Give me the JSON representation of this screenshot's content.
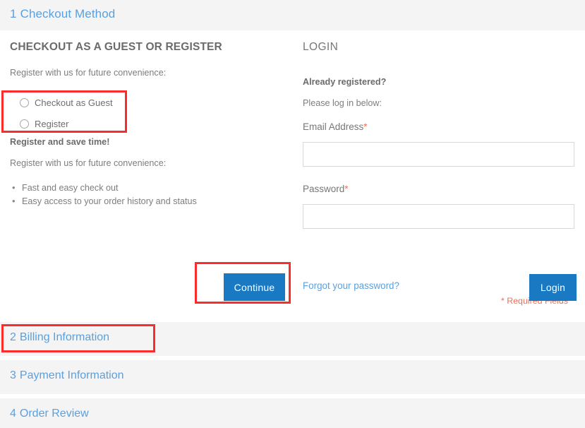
{
  "checkout": {
    "active_step": {
      "number": "1",
      "label": "Checkout Method"
    },
    "guest": {
      "heading": "CHECKOUT AS A GUEST OR REGISTER",
      "intro": "Register with us for future convenience:",
      "options": [
        {
          "label": "Checkout as Guest",
          "selected": false
        },
        {
          "label": "Register",
          "selected": false
        }
      ],
      "register_heading": "Register and save time!",
      "register_intro": "Register with us for future convenience:",
      "benefits": [
        "Fast and easy check out",
        "Easy access to your order history and status"
      ],
      "continue_label": "Continue"
    },
    "login": {
      "heading": "LOGIN",
      "already_registered": "Already registered?",
      "please_log_in": "Please log in below:",
      "email_label": "Email Address",
      "email_value": "",
      "email_placeholder": "",
      "password_label": "Password",
      "password_value": "",
      "password_placeholder": "",
      "required_marker": "*",
      "required_fields_note": "* Required Fields",
      "forgot_link": "Forgot your password?",
      "login_label": "Login"
    },
    "steps": [
      {
        "number": "2",
        "label": "Billing Information"
      },
      {
        "number": "3",
        "label": "Payment Information"
      },
      {
        "number": "4",
        "label": "Order Review"
      }
    ]
  },
  "colors": {
    "accent_blue": "#1979c3",
    "link_blue": "#5ba0dd",
    "required_red": "#e8705a",
    "annotation_red": "#fb2c2c",
    "panel_gray": "#f4f4f4"
  }
}
